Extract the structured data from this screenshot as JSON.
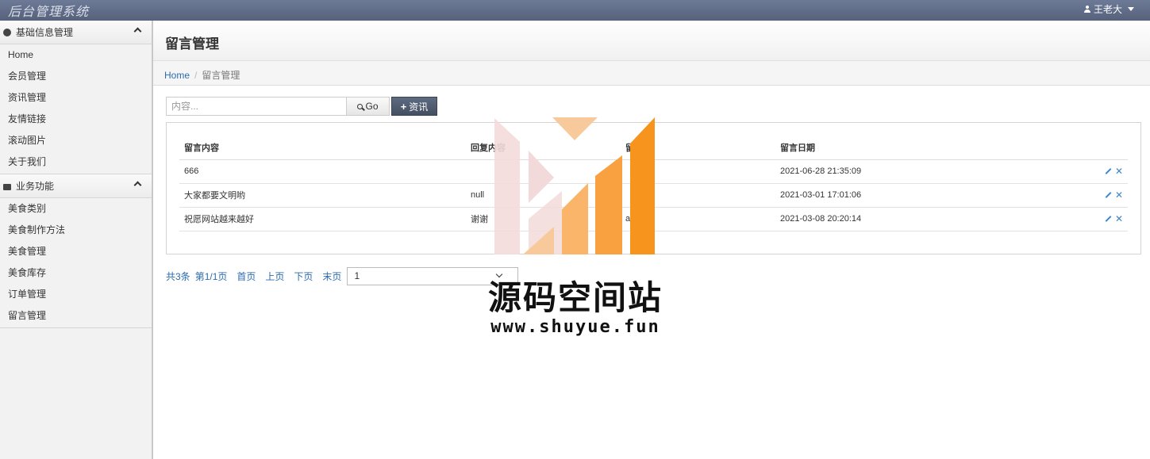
{
  "app": {
    "title": "后台管理系统",
    "user_name": "王老大"
  },
  "sidebar": {
    "sections": [
      {
        "label": "基础信息管理",
        "items": [
          "Home",
          "会员管理",
          "资讯管理",
          "友情链接",
          "滚动图片",
          "关于我们"
        ]
      },
      {
        "label": "业务功能",
        "items": [
          "美食类别",
          "美食制作方法",
          "美食管理",
          "美食库存",
          "订单管理",
          "留言管理"
        ]
      }
    ]
  },
  "page": {
    "title": "留言管理"
  },
  "breadcrumb": {
    "home": "Home",
    "current": "留言管理"
  },
  "toolbar": {
    "search_placeholder": "内容...",
    "go_label": "Go",
    "add_label": "资讯"
  },
  "table": {
    "headers": [
      "留言内容",
      "回复内容",
      "留言人",
      "留言日期"
    ],
    "rows": [
      {
        "content": "666",
        "reply": "",
        "user": "",
        "date": "2021-06-28 21:35:09"
      },
      {
        "content": "大家都要文明哟",
        "reply": "null",
        "user": "",
        "date": "2021-03-01 17:01:06"
      },
      {
        "content": "祝愿网站越来越好",
        "reply": "谢谢",
        "user": "an",
        "date": "2021-03-08 20:20:14"
      }
    ]
  },
  "pager": {
    "total": "共3条",
    "page": "第1/1页",
    "first": "首页",
    "prev": "上页",
    "next": "下页",
    "last": "末页",
    "select_value": "1"
  },
  "watermark": {
    "title": "源码空间站",
    "url": "www.shuyue.fun"
  },
  "colors": {
    "topbar": "#5f6b86",
    "link": "#2b6bb0",
    "accent_orange": "#f7941d"
  }
}
